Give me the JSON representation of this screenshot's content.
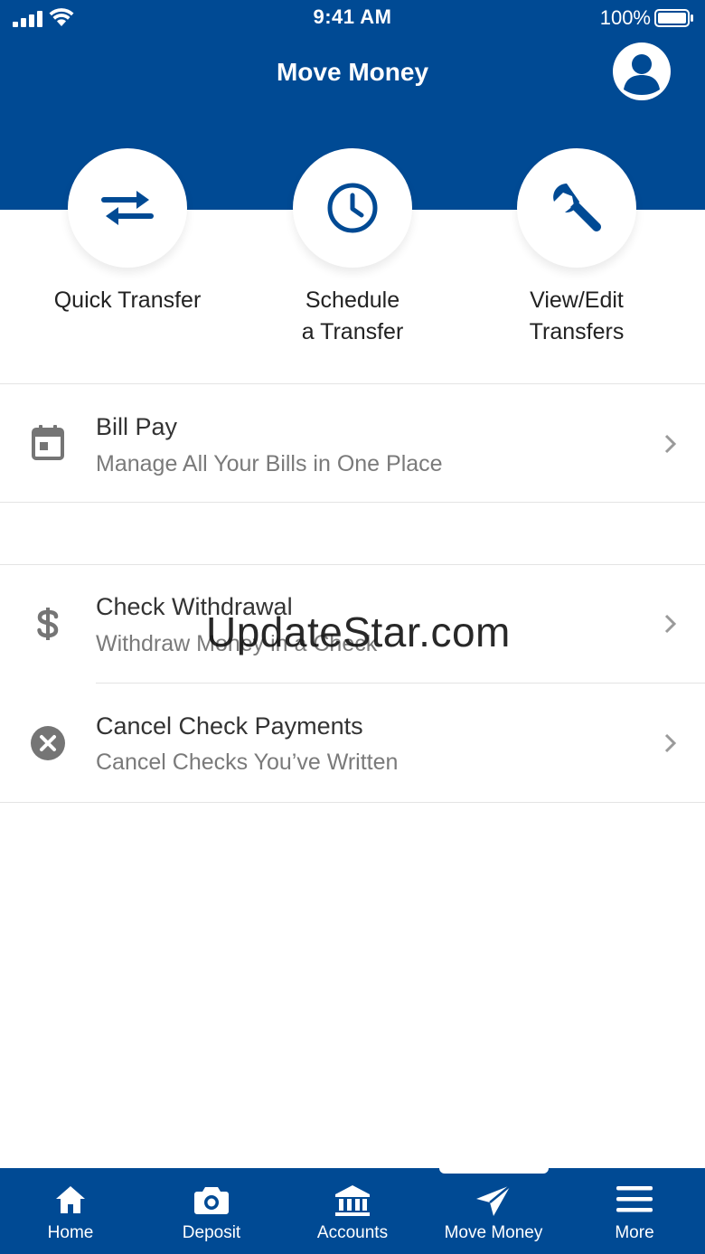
{
  "status_bar": {
    "time": "9:41 AM",
    "battery": "100%"
  },
  "header": {
    "title": "Move Money"
  },
  "actions": [
    {
      "label": "Quick Transfer",
      "icon": "swap-arrows-icon"
    },
    {
      "label": "Schedule\na Transfer",
      "icon": "clock-icon"
    },
    {
      "label": "View/Edit\nTransfers",
      "icon": "wrench-icon"
    }
  ],
  "list": [
    {
      "title": "Bill Pay",
      "subtitle": "Manage All Your Bills in One Place",
      "icon": "calendar-icon"
    },
    {
      "title": "Check Withdrawal",
      "subtitle": "Withdraw Money in a Check",
      "icon": "dollar-icon"
    },
    {
      "title": "Cancel Check Payments",
      "subtitle": "Cancel Checks You’ve Written",
      "icon": "cancel-circle-icon"
    }
  ],
  "watermark": "UpdateStar.com",
  "tabs": [
    {
      "label": "Home",
      "icon": "home-icon"
    },
    {
      "label": "Deposit",
      "icon": "camera-icon"
    },
    {
      "label": "Accounts",
      "icon": "bank-icon"
    },
    {
      "label": "Move Money",
      "icon": "send-icon",
      "active": true
    },
    {
      "label": "More",
      "icon": "menu-icon"
    }
  ],
  "colors": {
    "brand": "#004A94",
    "text": "#333333",
    "subtext": "#7a7a7a",
    "icon_gray": "#757575"
  }
}
